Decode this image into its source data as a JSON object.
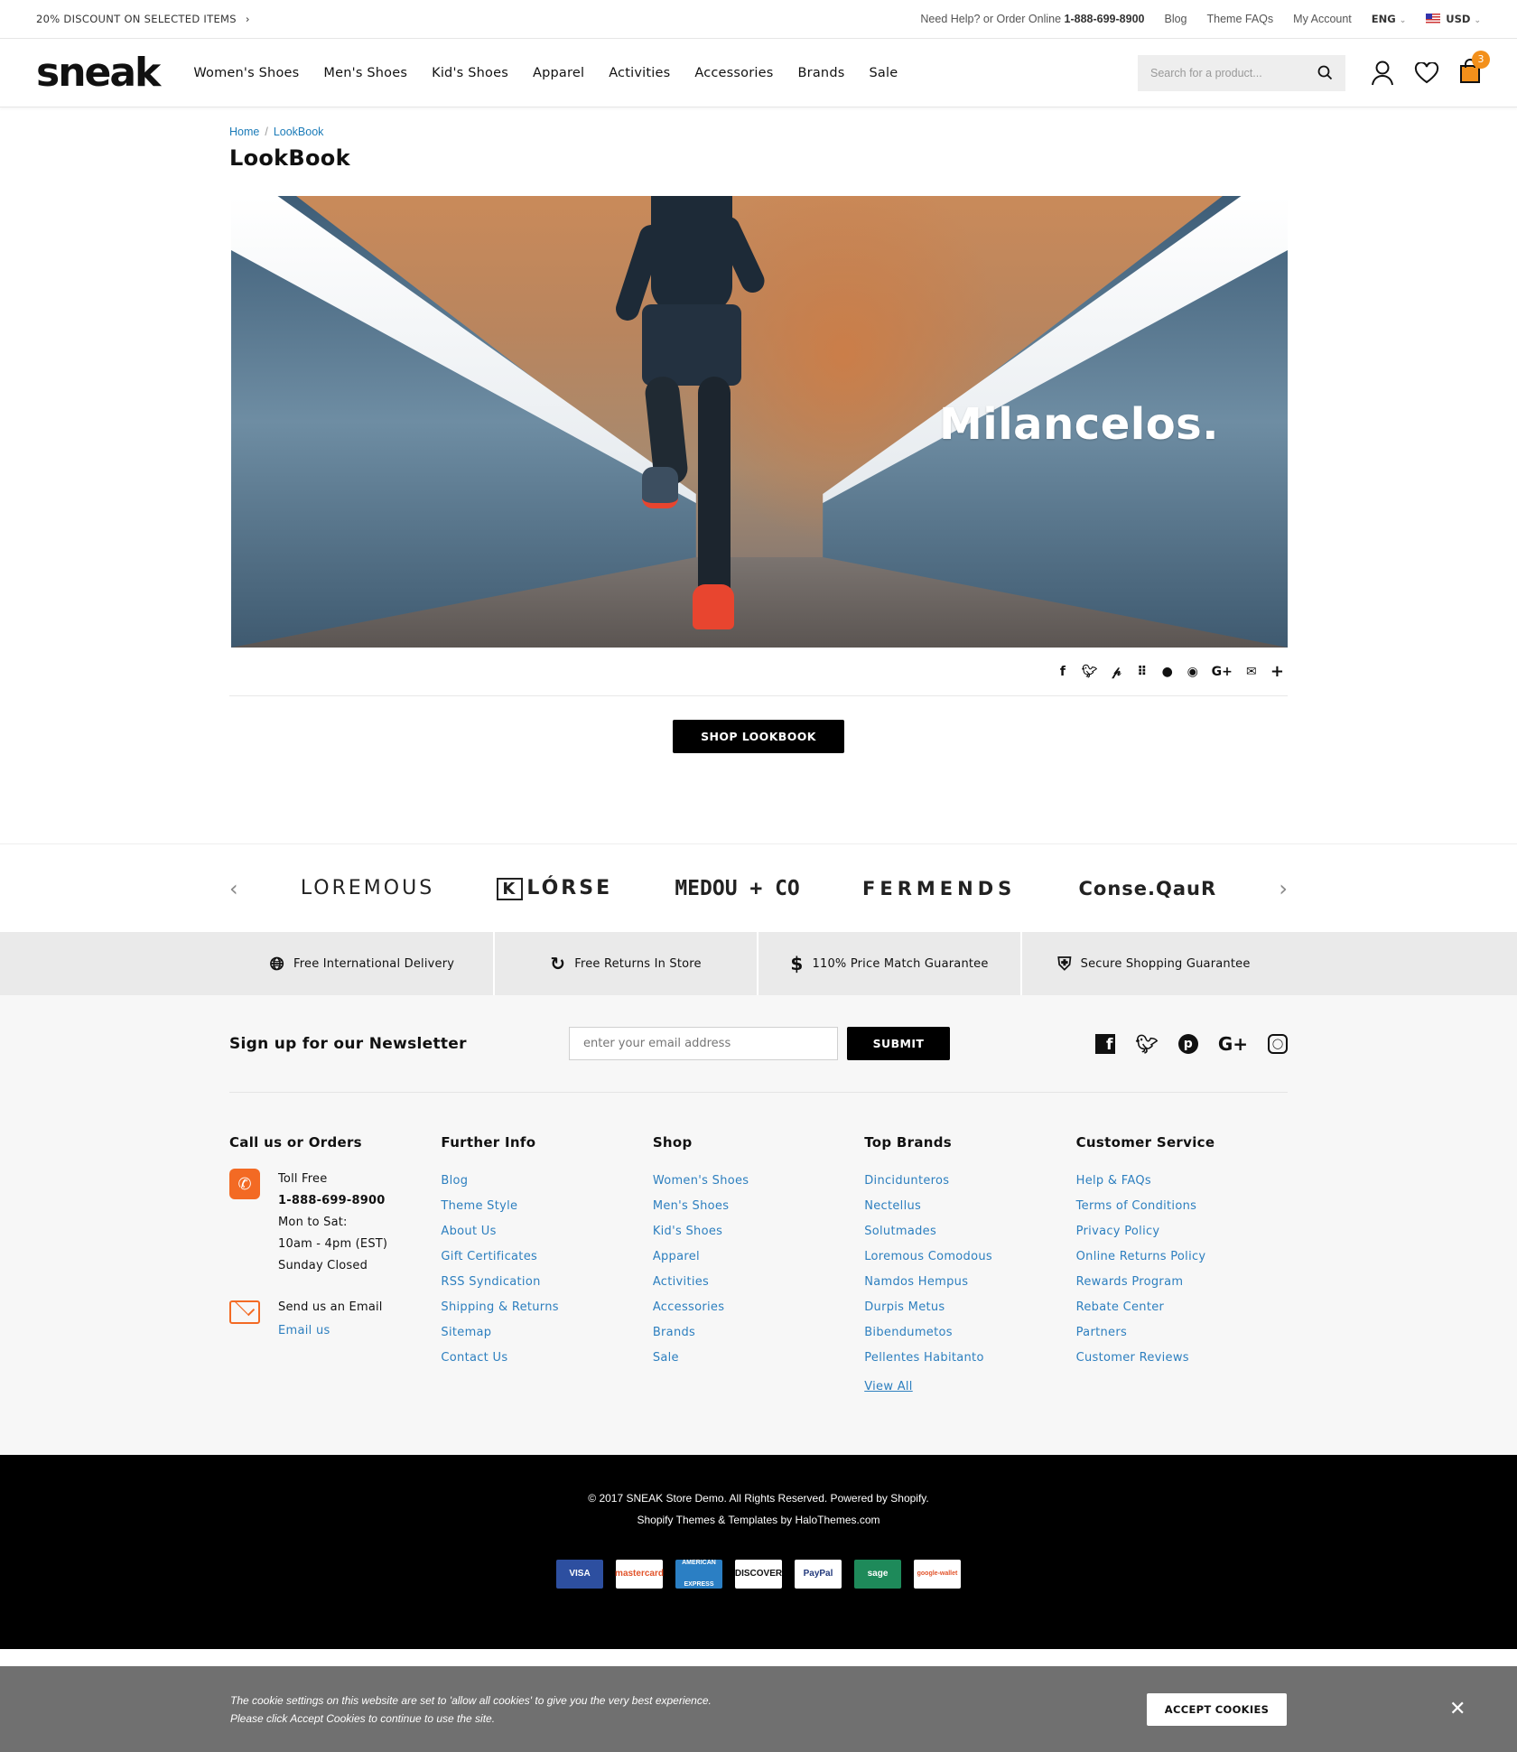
{
  "topbar": {
    "promo": "20% DISCOUNT ON SELECTED ITEMS",
    "promo_arrow": "›",
    "help_text": "Need Help? or Order Online",
    "phone": "1-888-699-8900",
    "links": [
      "Blog",
      "Theme FAQs",
      "My Account"
    ],
    "language": "ENG",
    "currency": "USD"
  },
  "header": {
    "logo": "sneak",
    "nav": [
      "Women's Shoes",
      "Men's Shoes",
      "Kid's Shoes",
      "Apparel",
      "Activities",
      "Accessories",
      "Brands",
      "Sale"
    ],
    "search_placeholder": "Search for a product...",
    "cart_count": "3"
  },
  "breadcrumb": {
    "home": "Home",
    "current": "LookBook"
  },
  "page_title": "LookBook",
  "hero": {
    "heading": "Milancelos."
  },
  "share_icons": [
    "facebook-icon",
    "twitter-icon",
    "pinterest-icon",
    "grid-icon",
    "tumblr-icon",
    "reddit-icon",
    "google-plus-icon",
    "email-icon",
    "plus-icon"
  ],
  "shop_button": "SHOP LOOKBOOK",
  "brands": [
    "LOREMOUS",
    "LÓRSE",
    "MEDOU + CO",
    "FERMENDS",
    "Conse.QauR"
  ],
  "brand_klorse_letter": "K",
  "features": [
    {
      "icon": "globe-icon",
      "label": "Free International Delivery"
    },
    {
      "icon": "refresh-icon",
      "label": "Free Returns In Store"
    },
    {
      "icon": "dollar-icon",
      "label": "110% Price Match Guarantee"
    },
    {
      "icon": "shield-icon",
      "label": "Secure Shopping Guarantee"
    }
  ],
  "newsletter": {
    "heading": "Sign up for our Newsletter",
    "placeholder": "enter your email address",
    "submit": "SUBMIT"
  },
  "footer": {
    "call": {
      "heading": "Call us or Orders",
      "toll_label": "Toll Free",
      "phone": "1-888-699-8900",
      "days": "Mon to Sat:",
      "hours": "10am - 4pm (EST)",
      "sunday": "Sunday Closed",
      "email_label": "Send us an Email",
      "email_link": "Email us"
    },
    "further": {
      "heading": "Further Info",
      "links": [
        "Blog",
        "Theme Style",
        "About Us",
        "Gift Certificates",
        "RSS Syndication",
        "Shipping & Returns",
        "Sitemap",
        "Contact Us"
      ]
    },
    "shop": {
      "heading": "Shop",
      "links": [
        "Women's Shoes",
        "Men's Shoes",
        "Kid's Shoes",
        "Apparel",
        "Activities",
        "Accessories",
        "Brands",
        "Sale"
      ]
    },
    "brands": {
      "heading": "Top Brands",
      "links": [
        "Dincidunteros",
        "Nectellus",
        "Solutmades",
        "Loremous Comodous",
        "Namdos Hempus",
        "Durpis Metus",
        "Bibendumetos",
        "Pellentes Habitanto"
      ],
      "view_all": "View All"
    },
    "service": {
      "heading": "Customer Service",
      "links": [
        "Help & FAQs",
        "Terms of Conditions",
        "Privacy Policy",
        "Online Returns Policy",
        "Rewards Program",
        "Rebate Center",
        "Partners",
        "Customer Reviews"
      ]
    }
  },
  "bottom": {
    "copyright": "© 2017 SNEAK Store Demo. All Rights Reserved. Powered by Shopify.",
    "credits": "Shopify Themes & Templates by HaloThemes.com",
    "payments": [
      {
        "name": "VISA",
        "bg": "#2d4fa0",
        "fg": "#ffffff"
      },
      {
        "name": "mastercard",
        "bg": "#ffffff",
        "fg": "#e2542b"
      },
      {
        "name": "AMERICAN EXPRESS",
        "bg": "#2b7fc4",
        "fg": "#ffffff"
      },
      {
        "name": "DISCOVER",
        "bg": "#ffffff",
        "fg": "#111111"
      },
      {
        "name": "PayPal",
        "bg": "#ffffff",
        "fg": "#233a7c"
      },
      {
        "name": "sage",
        "bg": "#1e8a5a",
        "fg": "#ffffff"
      },
      {
        "name": "google-wallet",
        "bg": "#ffffff",
        "fg": "#e2542b"
      }
    ]
  },
  "cookie": {
    "line1": "The cookie settings on this website are set to 'allow all cookies' to give you the very best experience.",
    "line2": "Please click Accept Cookies to continue to use the site.",
    "accept": "ACCEPT COOKIES",
    "close": "✕"
  },
  "colors": {
    "accent": "#f3901b",
    "link": "#2d7fbf",
    "orange_icon": "#f36a24"
  }
}
